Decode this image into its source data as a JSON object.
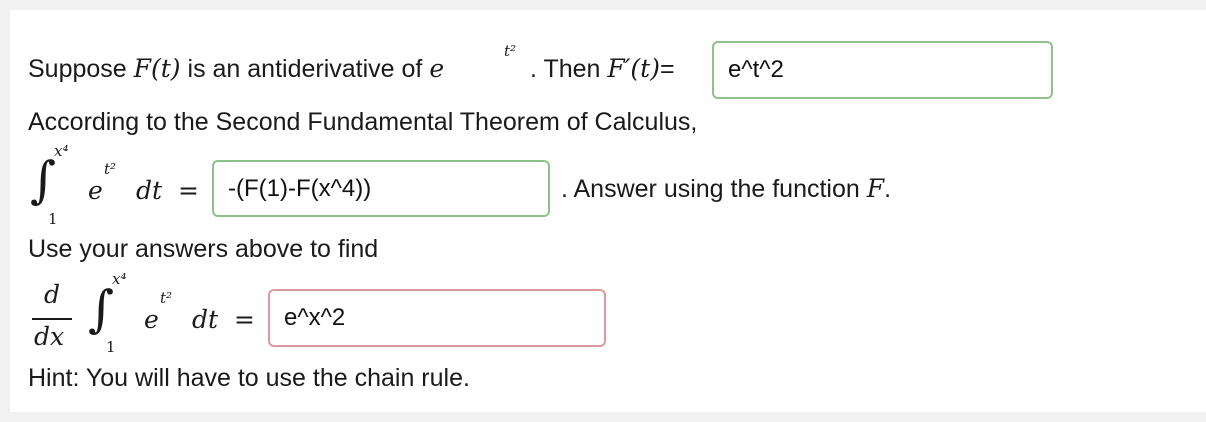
{
  "q1": {
    "prefix": "Suppose",
    "F_of_t": "F(t)",
    "middle": "is an antiderivative of",
    "base_e": "e",
    "exp": "t²",
    "then": ". Then",
    "Fprime": "F′(t)",
    "equals": "=",
    "answer": "e^t^2"
  },
  "q2": {
    "text": "According to the Second Fundamental Theorem of Calculus,",
    "upper_limit": "x⁴",
    "lower_limit": "1",
    "integrand_e": "e",
    "integrand_exp": "t²",
    "dt": "dt",
    "equals": "=",
    "answer": "-(F(1)-F(x^4))",
    "after": ". Answer using the function",
    "F": "F",
    "period": "."
  },
  "q3": {
    "text": "Use your answers above to find",
    "d": "d",
    "dx": "dx",
    "upper_limit": "x⁴",
    "lower_limit": "1",
    "integrand_e": "e",
    "integrand_exp": "t²",
    "dt": "dt",
    "equals": "=",
    "answer": "e^x^2"
  },
  "hint": "Hint: You will have to use the chain rule.",
  "colors": {
    "correct_border": "#8fc18a",
    "incorrect_border": "#d99a9a"
  }
}
